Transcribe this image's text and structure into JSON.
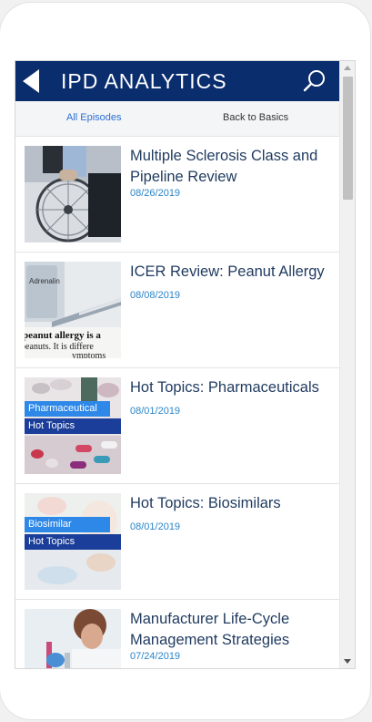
{
  "header": {
    "title": "IPD ANALYTICS",
    "bg_color": "#0a2d6e"
  },
  "subnav": {
    "all_episodes": "All Episodes",
    "back_to_basics": "Back to Basics"
  },
  "episodes": [
    {
      "title": "Multiple Sclerosis Class and Pipeline Review",
      "date": "08/26/2019",
      "thumb": "wheelchair"
    },
    {
      "title": "ICER Review: Peanut Allergy",
      "date": "08/08/2019",
      "thumb": "adrenaline-syringe"
    },
    {
      "title": "Hot Topics: Pharmaceuticals",
      "date": "08/01/2019",
      "thumb": "pills",
      "tag_top": "Pharmaceutical",
      "tag_bottom": "Hot Topics"
    },
    {
      "title": "Hot Topics: Biosimilars",
      "date": "08/01/2019",
      "thumb": "lab",
      "tag_top": "Biosimilar",
      "tag_bottom": "Hot Topics"
    },
    {
      "title": "Manufacturer Life-Cycle Management Strategies",
      "date": "07/24/2019",
      "thumb": "lab-worker"
    }
  ],
  "thumb_text": {
    "adrenalin": "Adrenalin",
    "peanut_line1": "peanut allergy is a",
    "peanut_line2": "peanuts. It is differe",
    "peanut_line3": "ymptoms"
  },
  "colors": {
    "link": "#2a6fd6",
    "date": "#2a85c8",
    "tag_light": "#2e88e8",
    "tag_dark": "#1b3e9a"
  }
}
